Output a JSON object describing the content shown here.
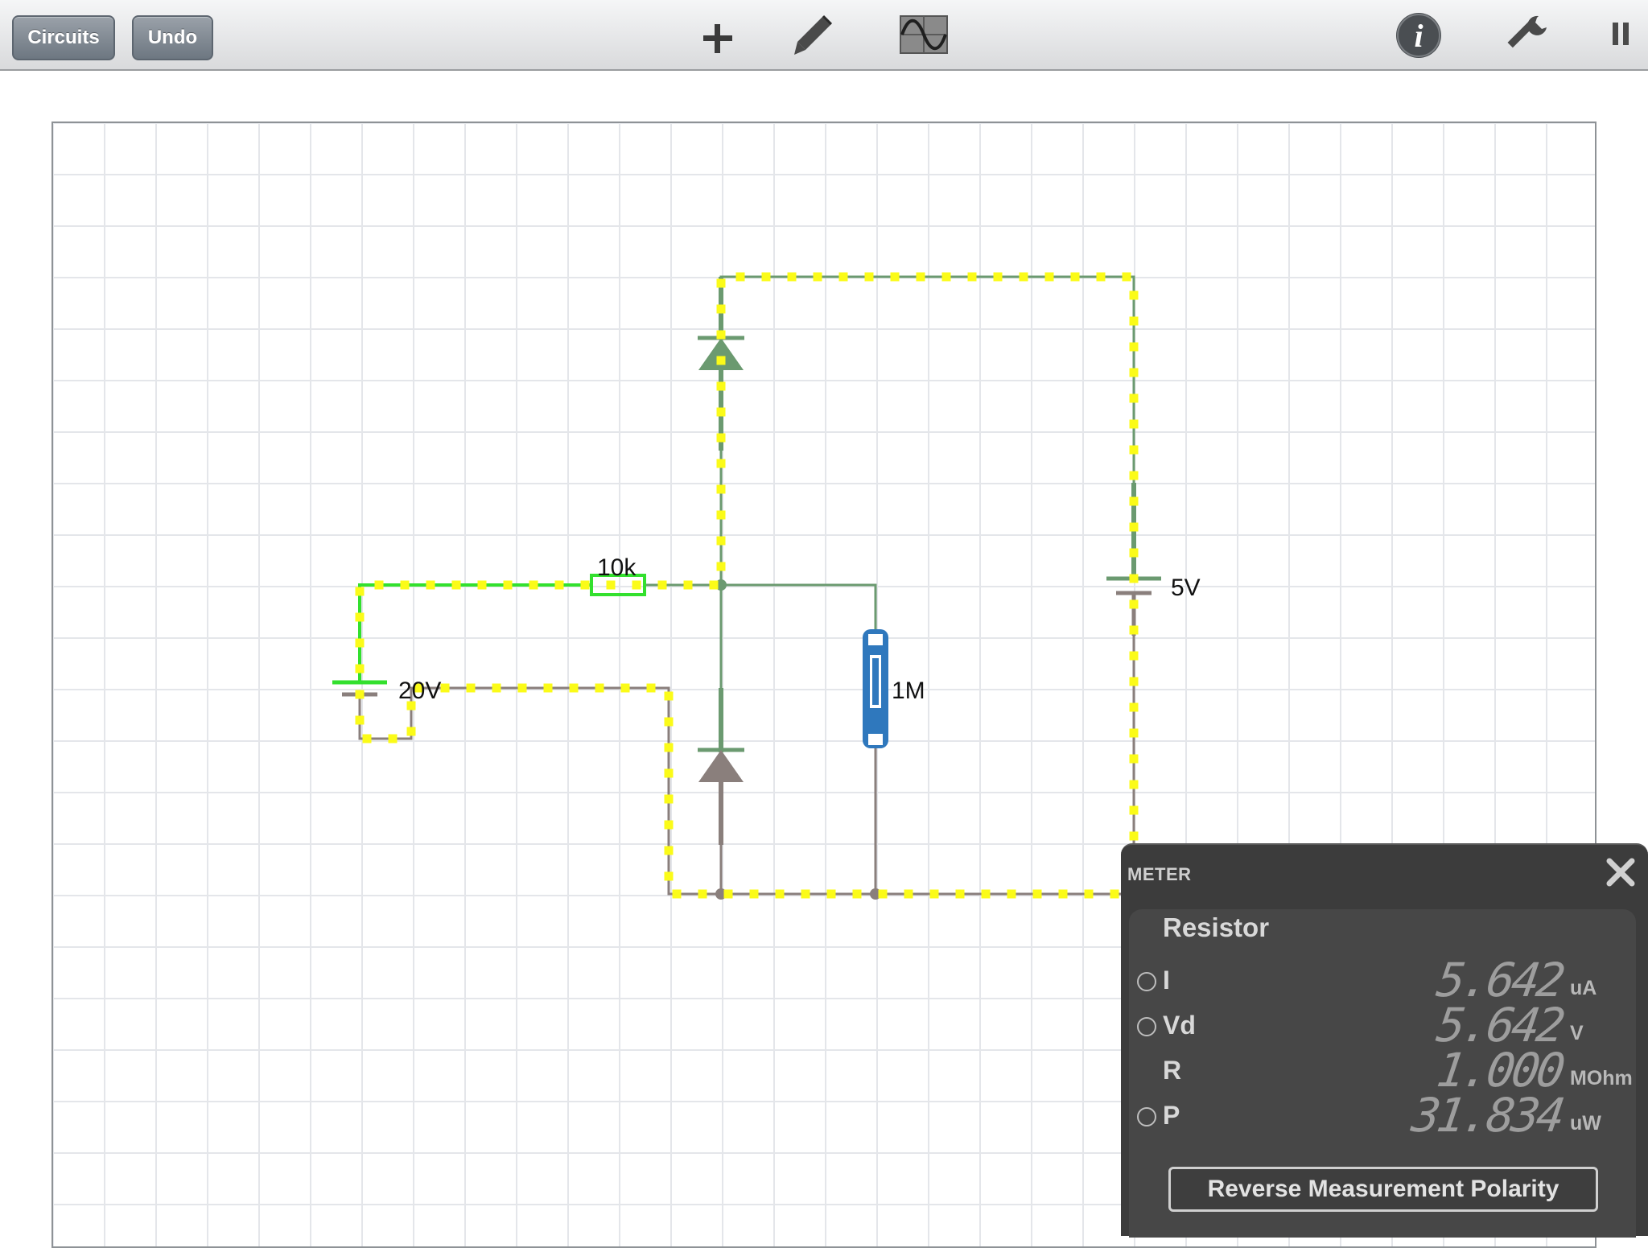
{
  "toolbar": {
    "circuits_label": "Circuits",
    "undo_label": "Undo",
    "icons": [
      "plus-icon",
      "pencil-icon",
      "oscilloscope-icon",
      "info-icon",
      "wrench-icon",
      "pause-icon"
    ]
  },
  "circuit": {
    "labels": {
      "resistor_10k": "10k",
      "battery_20v": "20V",
      "battery_5v": "5V",
      "resistor_1m": "1M"
    },
    "colors": {
      "wire_green": "#6b9a70",
      "wire_gray": "#8a7f7c",
      "selected_green": "#33e02e",
      "current_dots": "#fbfb18",
      "selected_resistor": "#2f78bd"
    }
  },
  "meter": {
    "title": "METER",
    "component": "Resistor",
    "rows": [
      {
        "label": "I",
        "value": "5.642",
        "unit": "uA",
        "has_radio": true
      },
      {
        "label": "Vd",
        "value": "5.642",
        "unit": "V",
        "has_radio": true
      },
      {
        "label": "R",
        "value": "1.000",
        "unit": "MOhm",
        "has_radio": false
      },
      {
        "label": "P",
        "value": "31.834",
        "unit": "uW",
        "has_radio": true
      }
    ],
    "reverse_label": "Reverse Measurement Polarity"
  }
}
